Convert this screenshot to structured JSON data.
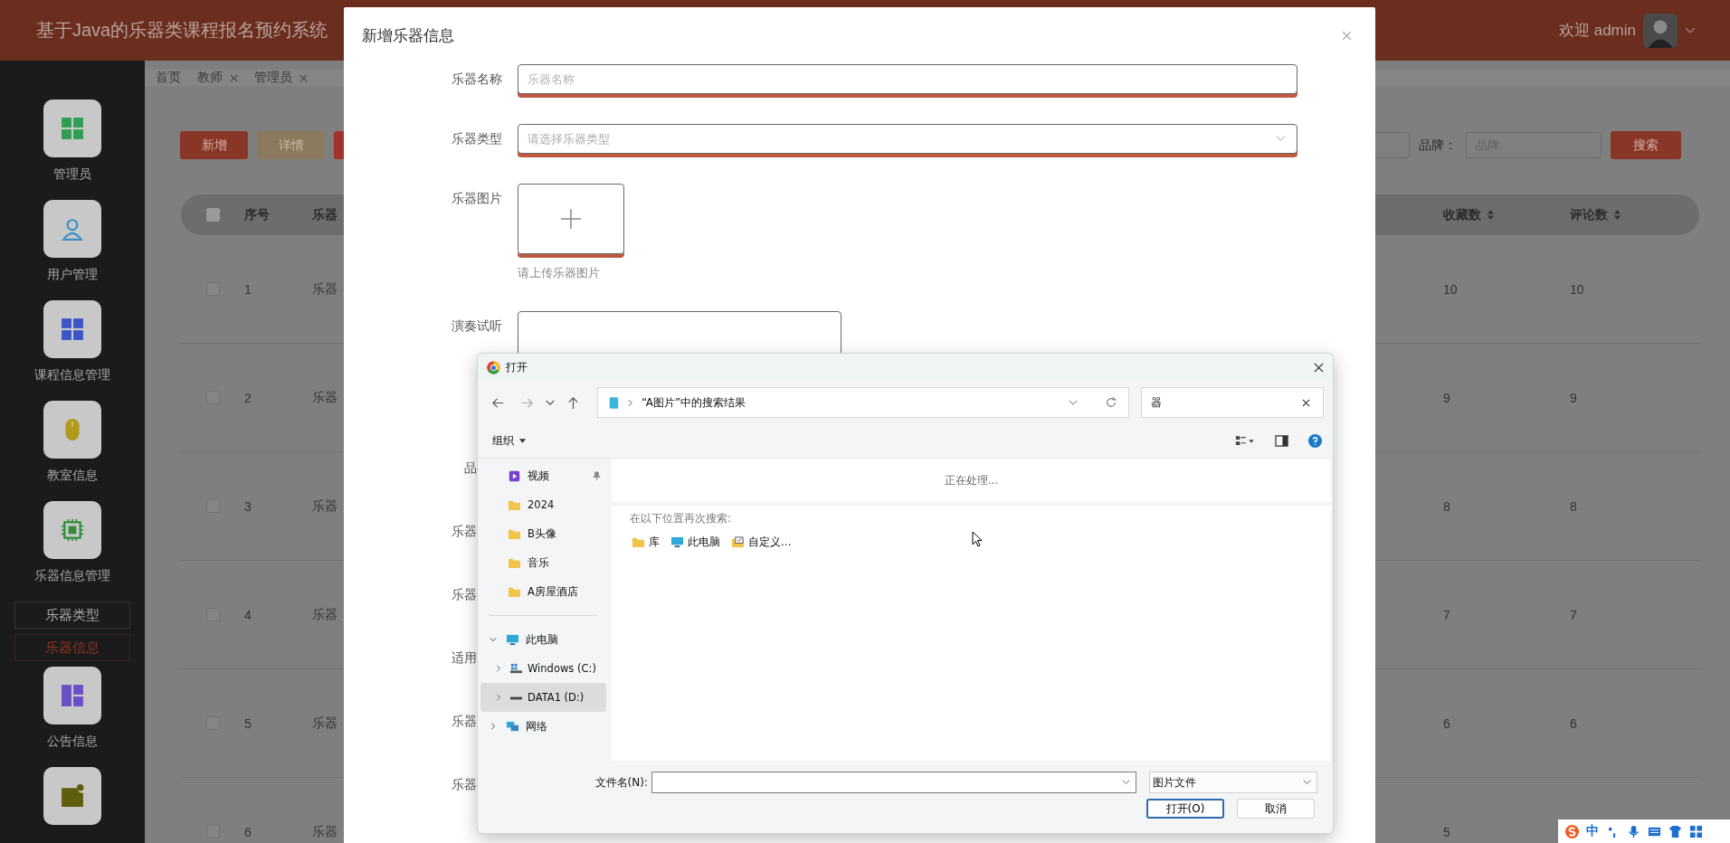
{
  "header": {
    "title": "基于Java的乐器类课程报名预约系统",
    "welcome": "欢迎 admin"
  },
  "sidebar": {
    "items": [
      {
        "label": "管理员",
        "kind": "grid-green"
      },
      {
        "label": "用户管理",
        "kind": "person"
      },
      {
        "label": "课程信息管理",
        "kind": "grid-blue"
      },
      {
        "label": "教室信息",
        "kind": "mouse"
      },
      {
        "label": "乐器信息管理",
        "kind": "chip",
        "children": [
          {
            "label": "乐器类型",
            "selected": false
          },
          {
            "label": "乐器信息",
            "selected": true
          }
        ]
      },
      {
        "label": "公告信息",
        "kind": "layout"
      },
      {
        "kind": "note"
      }
    ]
  },
  "tabs": [
    {
      "label": "首页",
      "closable": false
    },
    {
      "label": "教师",
      "closable": true
    },
    {
      "label": "管理员",
      "closable": true
    }
  ],
  "toolbar": {
    "buttons": [
      {
        "label": "新增",
        "kind": "add"
      },
      {
        "label": "详情",
        "kind": "detail"
      },
      {
        "kind": "delete"
      }
    ]
  },
  "search": {
    "fields": [
      {
        "kind": "input"
      },
      {
        "kind": "input",
        "label": "品牌：",
        "placeholder": "品牌"
      }
    ],
    "button": "搜索"
  },
  "table": {
    "all_checked": false,
    "columns": [
      {
        "label": "序号"
      },
      {
        "label": "乐器"
      },
      {
        "label": "收藏数",
        "sortable": true
      },
      {
        "label": "评论数",
        "sortable": true
      }
    ],
    "rows": [
      {
        "checked": false,
        "cells": [
          "1",
          "乐器",
          "10",
          "10"
        ]
      },
      {
        "checked": false,
        "cells": [
          "2",
          "乐器",
          "9",
          "9"
        ]
      },
      {
        "checked": false,
        "cells": [
          "3",
          "乐器",
          "8",
          "8"
        ]
      },
      {
        "checked": false,
        "cells": [
          "4",
          "乐器",
          "7",
          "7"
        ]
      },
      {
        "checked": false,
        "cells": [
          "5",
          "乐器",
          "6",
          "6"
        ]
      },
      {
        "checked": false,
        "cells": [
          "6",
          "乐器",
          "5"
        ]
      }
    ]
  },
  "modal": {
    "title": "新增乐器信息",
    "fields": [
      {
        "label": "乐器名称",
        "kind": "text",
        "placeholder": "乐器名称"
      },
      {
        "label": "乐器类型",
        "kind": "select",
        "placeholder": "请选择乐器类型"
      },
      {
        "label": "乐器图片",
        "kind": "upload",
        "hint": "请上传乐器图片"
      },
      {
        "label": "演奏试听",
        "kind": "file"
      },
      {
        "label": "品",
        "kind": "covered"
      },
      {
        "label": "乐器",
        "kind": "covered"
      },
      {
        "label": "乐器",
        "kind": "covered"
      },
      {
        "label": "适用",
        "kind": "covered"
      },
      {
        "label": "乐器",
        "kind": "covered"
      },
      {
        "label": "乐器",
        "kind": "covered"
      }
    ]
  },
  "file_dialog": {
    "title": "打开",
    "path": "“A图片”中的搜索结果",
    "search_value": "器",
    "organize": "组织",
    "quick_access": [
      {
        "label": "视频",
        "kind": "video",
        "pinned": true,
        "selected": false
      },
      {
        "label": "2024",
        "kind": "folder",
        "pinned": false,
        "selected": false
      },
      {
        "label": "B头像",
        "kind": "folder",
        "pinned": false,
        "selected": false
      },
      {
        "label": "音乐",
        "kind": "folder",
        "pinned": false,
        "selected": false
      },
      {
        "label": "A房屋酒店",
        "kind": "folder",
        "pinned": false,
        "selected": false
      }
    ],
    "tree": [
      {
        "label": "此电脑",
        "kind": "pc",
        "expanded": true,
        "selected": false,
        "children": [
          {
            "label": "Windows (C:)",
            "kind": "os-drive",
            "expanded": false,
            "selected": false
          },
          {
            "label": "DATA1 (D:)",
            "kind": "drive",
            "expanded": false,
            "selected": true
          }
        ]
      },
      {
        "label": "网络",
        "kind": "network",
        "expanded": false,
        "selected": false
      }
    ],
    "status": "正在处理...",
    "search_again": "在以下位置再次搜索:",
    "locations": [
      {
        "label": "库",
        "kind": "folder"
      },
      {
        "label": "此电脑",
        "kind": "pc"
      },
      {
        "label": "自定义...",
        "kind": "custom"
      }
    ],
    "filename_label": "文件名(N):",
    "filetype": "图片文件",
    "buttons": [
      {
        "label": "打开(O)",
        "default": true
      },
      {
        "label": "取消",
        "default": false
      }
    ]
  },
  "ime": {
    "label": "中"
  }
}
